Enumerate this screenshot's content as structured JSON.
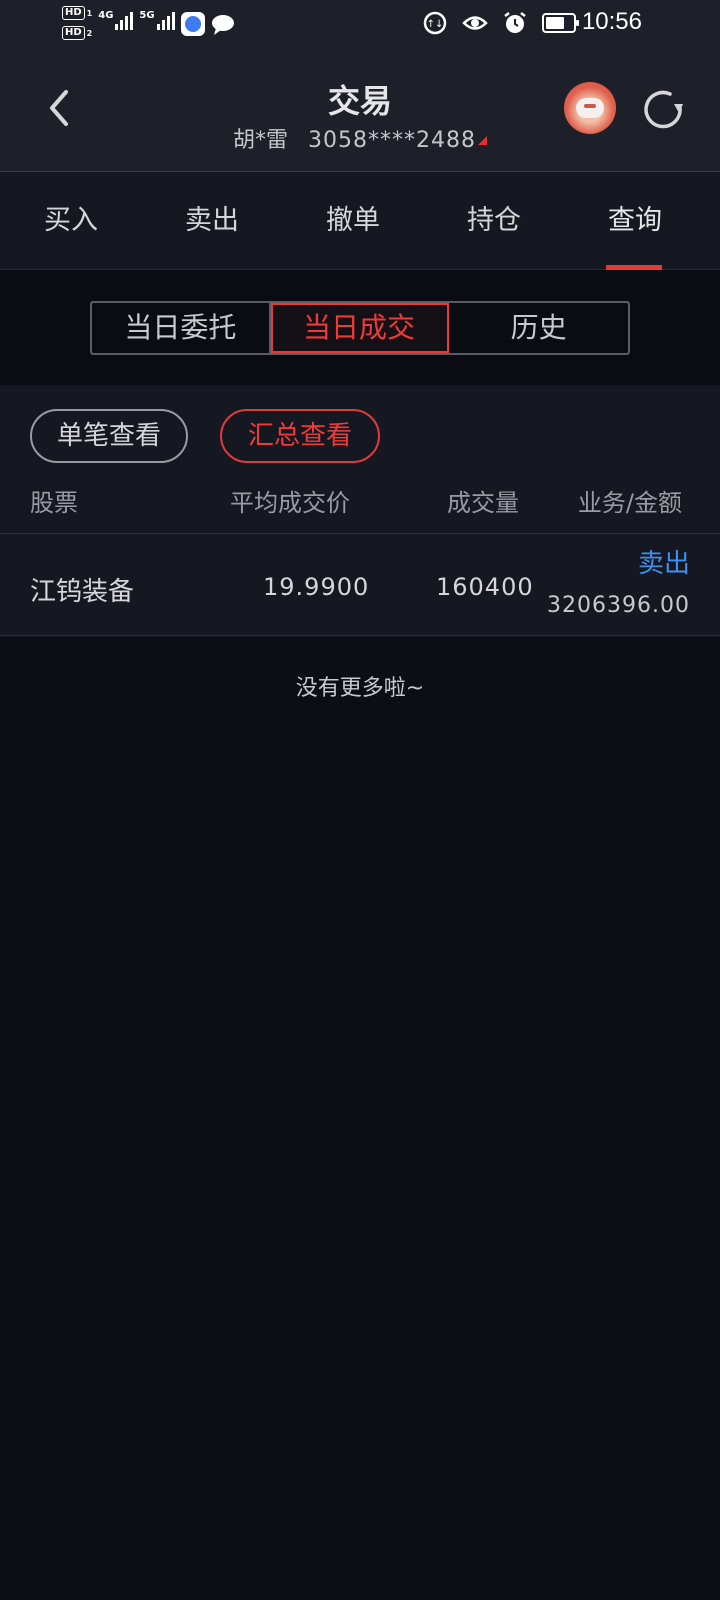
{
  "status_bar": {
    "sim1_label": "HD",
    "sim1_num": "1",
    "sim2_label": "HD",
    "sim2_num": "2",
    "net1": "4G",
    "net2": "5G",
    "time": "10:56",
    "icons": [
      "hd-icon",
      "signal-icon",
      "app-icon",
      "message-icon",
      "data-saver-icon",
      "eye-icon",
      "alarm-icon",
      "battery-icon"
    ]
  },
  "header": {
    "title": "交易",
    "account_name": "胡*雷",
    "account_number": "3058****2488"
  },
  "main_tabs": [
    {
      "label": "买入"
    },
    {
      "label": "卖出"
    },
    {
      "label": "撤单"
    },
    {
      "label": "持仓"
    },
    {
      "label": "查询",
      "active": true
    }
  ],
  "segments": [
    {
      "label": "当日委托"
    },
    {
      "label": "当日成交",
      "active": true
    },
    {
      "label": "历史"
    }
  ],
  "view_pills": [
    {
      "label": "单笔查看"
    },
    {
      "label": "汇总查看",
      "active": true
    }
  ],
  "columns": {
    "stock": "股票",
    "avg_price": "平均成交价",
    "volume": "成交量",
    "business_amount": "业务/金额"
  },
  "rows": [
    {
      "stock": "江钨装备",
      "avg_price": "19.9900",
      "volume": "160400",
      "action": "卖出",
      "amount": "3206396.00"
    }
  ],
  "footer_text": "没有更多啦~",
  "colors": {
    "accent_red": "#e33a3a",
    "action_blue": "#3e8ff0",
    "background": "#0c0d15"
  }
}
